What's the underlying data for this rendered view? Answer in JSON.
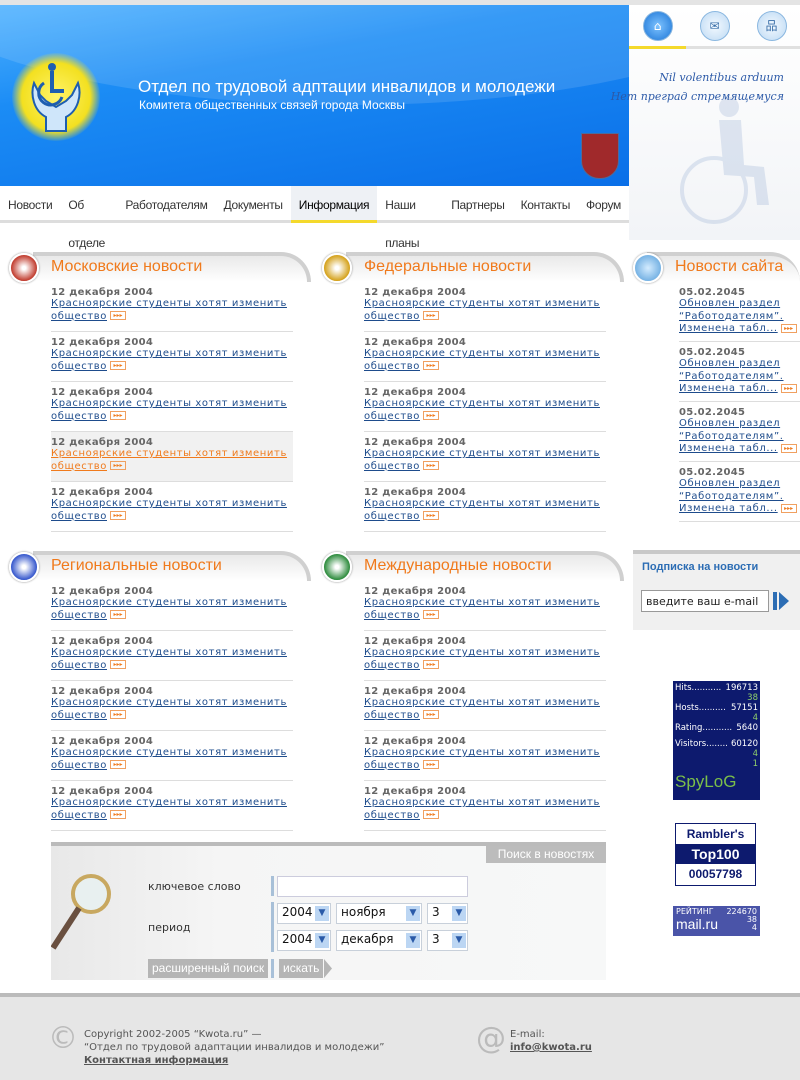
{
  "header": {
    "title": "Отдел по трудовой адптации  инвалидов и молодежи",
    "subtitle": "Комитета общественных связей города Москвы"
  },
  "top_icons": [
    {
      "name": "home-icon",
      "glyph": "⌂"
    },
    {
      "name": "mail-icon",
      "glyph": "✉"
    },
    {
      "name": "sitemap-icon",
      "glyph": "品"
    }
  ],
  "motto": {
    "latin": "Nil volentibus arduum",
    "russian": "Нет преград стремящемуся"
  },
  "nav": [
    "Новости",
    "Об отделе",
    "Работодателям",
    "Документы",
    "Информация",
    "Наши планы",
    "Партнеры",
    "Контакты",
    "Форум"
  ],
  "nav_active": 4,
  "sections": [
    {
      "title": "Московские новости",
      "icon": "moscow-emblem-icon",
      "color": "#c0392b",
      "highlight": 3,
      "items": [
        {
          "date": "12 декабря 2004",
          "title_1": "Красноярские студенты хотят изменить",
          "title_2": "общество"
        },
        {
          "date": "12 декабря 2004",
          "title_1": "Красноярские студенты хотят изменить",
          "title_2": "общество"
        },
        {
          "date": "12 декабря 2004",
          "title_1": "Красноярские студенты хотят изменить",
          "title_2": "общество"
        },
        {
          "date": "12 декабря 2004",
          "title_1": "Красноярские студенты хотят изменить",
          "title_2": "общество"
        },
        {
          "date": "12 декабря 2004",
          "title_1": "Красноярские студенты хотят изменить",
          "title_2": "общество"
        }
      ]
    },
    {
      "title": "Федеральные новости",
      "icon": "russia-emblem-icon",
      "color": "#d4a017",
      "highlight": -1,
      "items": [
        {
          "date": "12 декабря 2004",
          "title_1": "Красноярские студенты хотят изменить",
          "title_2": "общество"
        },
        {
          "date": "12 декабря 2004",
          "title_1": "Красноярские студенты хотят изменить",
          "title_2": "общество"
        },
        {
          "date": "12 декабря 2004",
          "title_1": "Красноярские студенты хотят изменить",
          "title_2": "общество"
        },
        {
          "date": "12 декабря 2004",
          "title_1": "Красноярские студенты хотят изменить",
          "title_2": "общество"
        },
        {
          "date": "12 декабря 2004",
          "title_1": "Красноярские студенты хотят изменить",
          "title_2": "общество"
        }
      ]
    },
    {
      "title": "Региональные новости",
      "icon": "russia-flag-icon",
      "color": "#3355cc",
      "highlight": -1,
      "items": [
        {
          "date": "12 декабря 2004",
          "title_1": "Красноярские студенты хотят изменить",
          "title_2": "общество"
        },
        {
          "date": "12 декабря 2004",
          "title_1": "Красноярские студенты хотят изменить",
          "title_2": "общество"
        },
        {
          "date": "12 декабря 2004",
          "title_1": "Красноярские студенты хотят изменить",
          "title_2": "общество"
        },
        {
          "date": "12 декабря 2004",
          "title_1": "Красноярские студенты хотят изменить",
          "title_2": "общество"
        },
        {
          "date": "12 декабря 2004",
          "title_1": "Красноярские студенты хотят изменить",
          "title_2": "общество"
        }
      ]
    },
    {
      "title": "Международные новости",
      "icon": "globe-icon",
      "color": "#2a8a3a",
      "highlight": -1,
      "items": [
        {
          "date": "12 декабря 2004",
          "title_1": "Красноярские студенты хотят изменить",
          "title_2": "общество"
        },
        {
          "date": "12 декабря 2004",
          "title_1": "Красноярские студенты хотят изменить",
          "title_2": "общество"
        },
        {
          "date": "12 декабря 2004",
          "title_1": "Красноярские студенты хотят изменить",
          "title_2": "общество"
        },
        {
          "date": "12 декабря 2004",
          "title_1": "Красноярские студенты хотят изменить",
          "title_2": "общество"
        },
        {
          "date": "12 декабря 2004",
          "title_1": "Красноярские студенты хотят изменить",
          "title_2": "общество"
        }
      ]
    }
  ],
  "site_news": {
    "title": "Новости сайта",
    "items": [
      {
        "date": "05.02.2045",
        "line_1": "Обновлен раздел",
        "line_2": "“Работодателям”.",
        "line_3": "Изменена табл..."
      },
      {
        "date": "05.02.2045",
        "line_1": "Обновлен раздел",
        "line_2": "“Работодателям”.",
        "line_3": "Изменена табл..."
      },
      {
        "date": "05.02.2045",
        "line_1": "Обновлен раздел",
        "line_2": "“Работодателям”.",
        "line_3": "Изменена табл..."
      },
      {
        "date": "05.02.2045",
        "line_1": "Обновлен раздел",
        "line_2": "“Работодателям”.",
        "line_3": "Изменена табл..."
      }
    ]
  },
  "more_glyph": "▸▸▸",
  "subscribe": {
    "title": "Подписка на новости",
    "value": "введите ваш e-mail"
  },
  "spylog": {
    "rows": [
      {
        "label": "Hits",
        "dots": "...........",
        "value": "196713",
        "sub": "38"
      },
      {
        "label": "Hosts",
        "dots": "..........",
        "value": "57151",
        "sub": "4"
      },
      {
        "label": "Rating",
        "dots": "...........",
        "value": "5640",
        "sub": ""
      },
      {
        "label": "Visitors",
        "dots": "........",
        "value": "60120",
        "sub": "4"
      }
    ],
    "extra": "1",
    "logo": "SpyLoG"
  },
  "rambler": {
    "line1": "Rambler's",
    "line2": "Top100",
    "line3": "00057798"
  },
  "mailru": {
    "label": "РЕЙТИНГ",
    "value": "224670",
    "logo": "mail.ru",
    "sub1": "38",
    "sub2": "4"
  },
  "search": {
    "tab": "Поиск в новостях",
    "keyword_label": "ключевое слово",
    "keyword_value": "",
    "period_label": "период",
    "from": {
      "year": "2004",
      "month": "ноября",
      "day": "3"
    },
    "to": {
      "year": "2004",
      "month": "декабря",
      "day": "3"
    },
    "advanced": "расширенный поиск",
    "submit": "искать"
  },
  "footer": {
    "copyright": "Copyright 2002-2005 “Kwota.ru” —",
    "org": "“Отдел по трудовой адаптации инвалидов и молодежи”",
    "contact": "Контактная информация",
    "email_label": "E-mail:",
    "email": "info@kwota.ru"
  }
}
